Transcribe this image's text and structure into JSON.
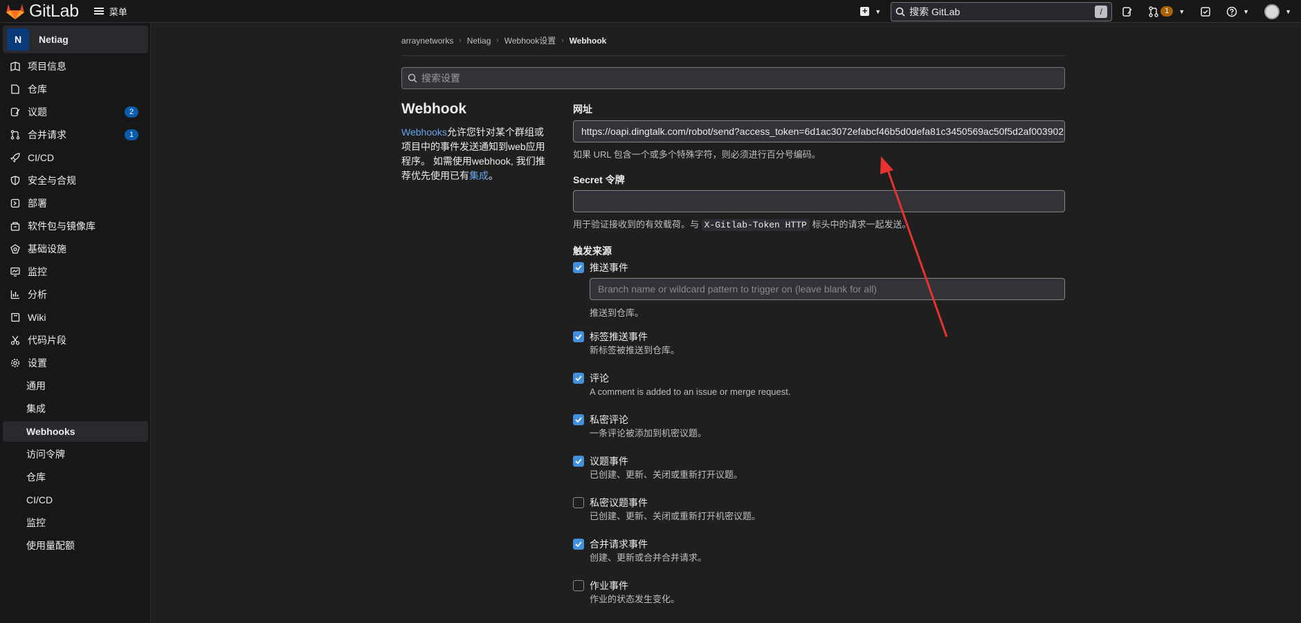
{
  "topbar": {
    "brand": "GitLab",
    "menu_label": "菜单",
    "search_text": "搜索 GitLab",
    "search_shortcut": "/",
    "mr_count": "1"
  },
  "sidebar": {
    "project_initial": "N",
    "project_name": "Netiag",
    "items": [
      {
        "label": "项目信息",
        "icon": "project-info-icon"
      },
      {
        "label": "仓库",
        "icon": "repository-icon"
      },
      {
        "label": "议题",
        "icon": "issues-icon",
        "count": "2"
      },
      {
        "label": "合并请求",
        "icon": "merge-request-icon",
        "count": "1"
      },
      {
        "label": "CI/CD",
        "icon": "rocket-icon"
      },
      {
        "label": "安全与合规",
        "icon": "shield-icon"
      },
      {
        "label": "部署",
        "icon": "deployments-icon"
      },
      {
        "label": "软件包与镜像库",
        "icon": "package-icon"
      },
      {
        "label": "基础设施",
        "icon": "cloud-gear-icon"
      },
      {
        "label": "监控",
        "icon": "monitor-icon"
      },
      {
        "label": "分析",
        "icon": "chart-icon"
      },
      {
        "label": "Wiki",
        "icon": "book-icon"
      },
      {
        "label": "代码片段",
        "icon": "scissors-icon"
      },
      {
        "label": "设置",
        "icon": "settings-gear-icon"
      }
    ],
    "sub_items": [
      "通用",
      "集成",
      "Webhooks",
      "访问令牌",
      "仓库",
      "CI/CD",
      "监控",
      "使用量配额"
    ]
  },
  "breadcrumb": [
    "arraynetworks",
    "Netiag",
    "Webhook设置",
    "Webhook"
  ],
  "settings_search": {
    "placeholder": "搜索设置"
  },
  "section": {
    "title": "Webhook",
    "desc_link": "Webhooks",
    "desc_text": "允许您针对某个群组或项目中的事件发送通知到web应用程序。 如需使用webhook, 我们推荐优先使用已有",
    "desc_link2": "集成",
    "desc_end": "。"
  },
  "form": {
    "url_label": "网址",
    "url_value": "https://oapi.dingtalk.com/robot/send?access_token=6d1ac3072efabcf46b5d0defa81c3450569ac50f5d2af003902",
    "url_help": "如果 URL 包含一个或多个特殊字符，则必须进行百分号编码。",
    "secret_label": "Secret 令牌",
    "secret_value": "",
    "secret_help_pre": "用于验证接收到的有效载荷。与 ",
    "secret_help_code": "X-Gitlab-Token HTTP",
    "secret_help_post": " 标头中的请求一起发送。",
    "trigger_label": "触发来源",
    "branch_placeholder": "Branch name or wildcard pattern to trigger on (leave blank for all)",
    "triggers": [
      {
        "label": "推送事件",
        "help": "推送到仓库。",
        "checked": true
      },
      {
        "label": "标签推送事件",
        "help": "新标签被推送到仓库。",
        "checked": true
      },
      {
        "label": "评论",
        "help": "A comment is added to an issue or merge request.",
        "checked": true
      },
      {
        "label": "私密评论",
        "help": "一条评论被添加到机密议题。",
        "checked": true
      },
      {
        "label": "议题事件",
        "help": "已创建、更新、关闭或重新打开议题。",
        "checked": true
      },
      {
        "label": "私密议题事件",
        "help": "已创建、更新、关闭或重新打开机密议题。",
        "checked": false
      },
      {
        "label": "合并请求事件",
        "help": "创建、更新或合并合并请求。",
        "checked": true
      },
      {
        "label": "作业事件",
        "help": "作业的状态发生变化。",
        "checked": false
      }
    ]
  },
  "colors": {
    "accent": "#428fdc",
    "annotation_arrow": "#e8322f"
  }
}
